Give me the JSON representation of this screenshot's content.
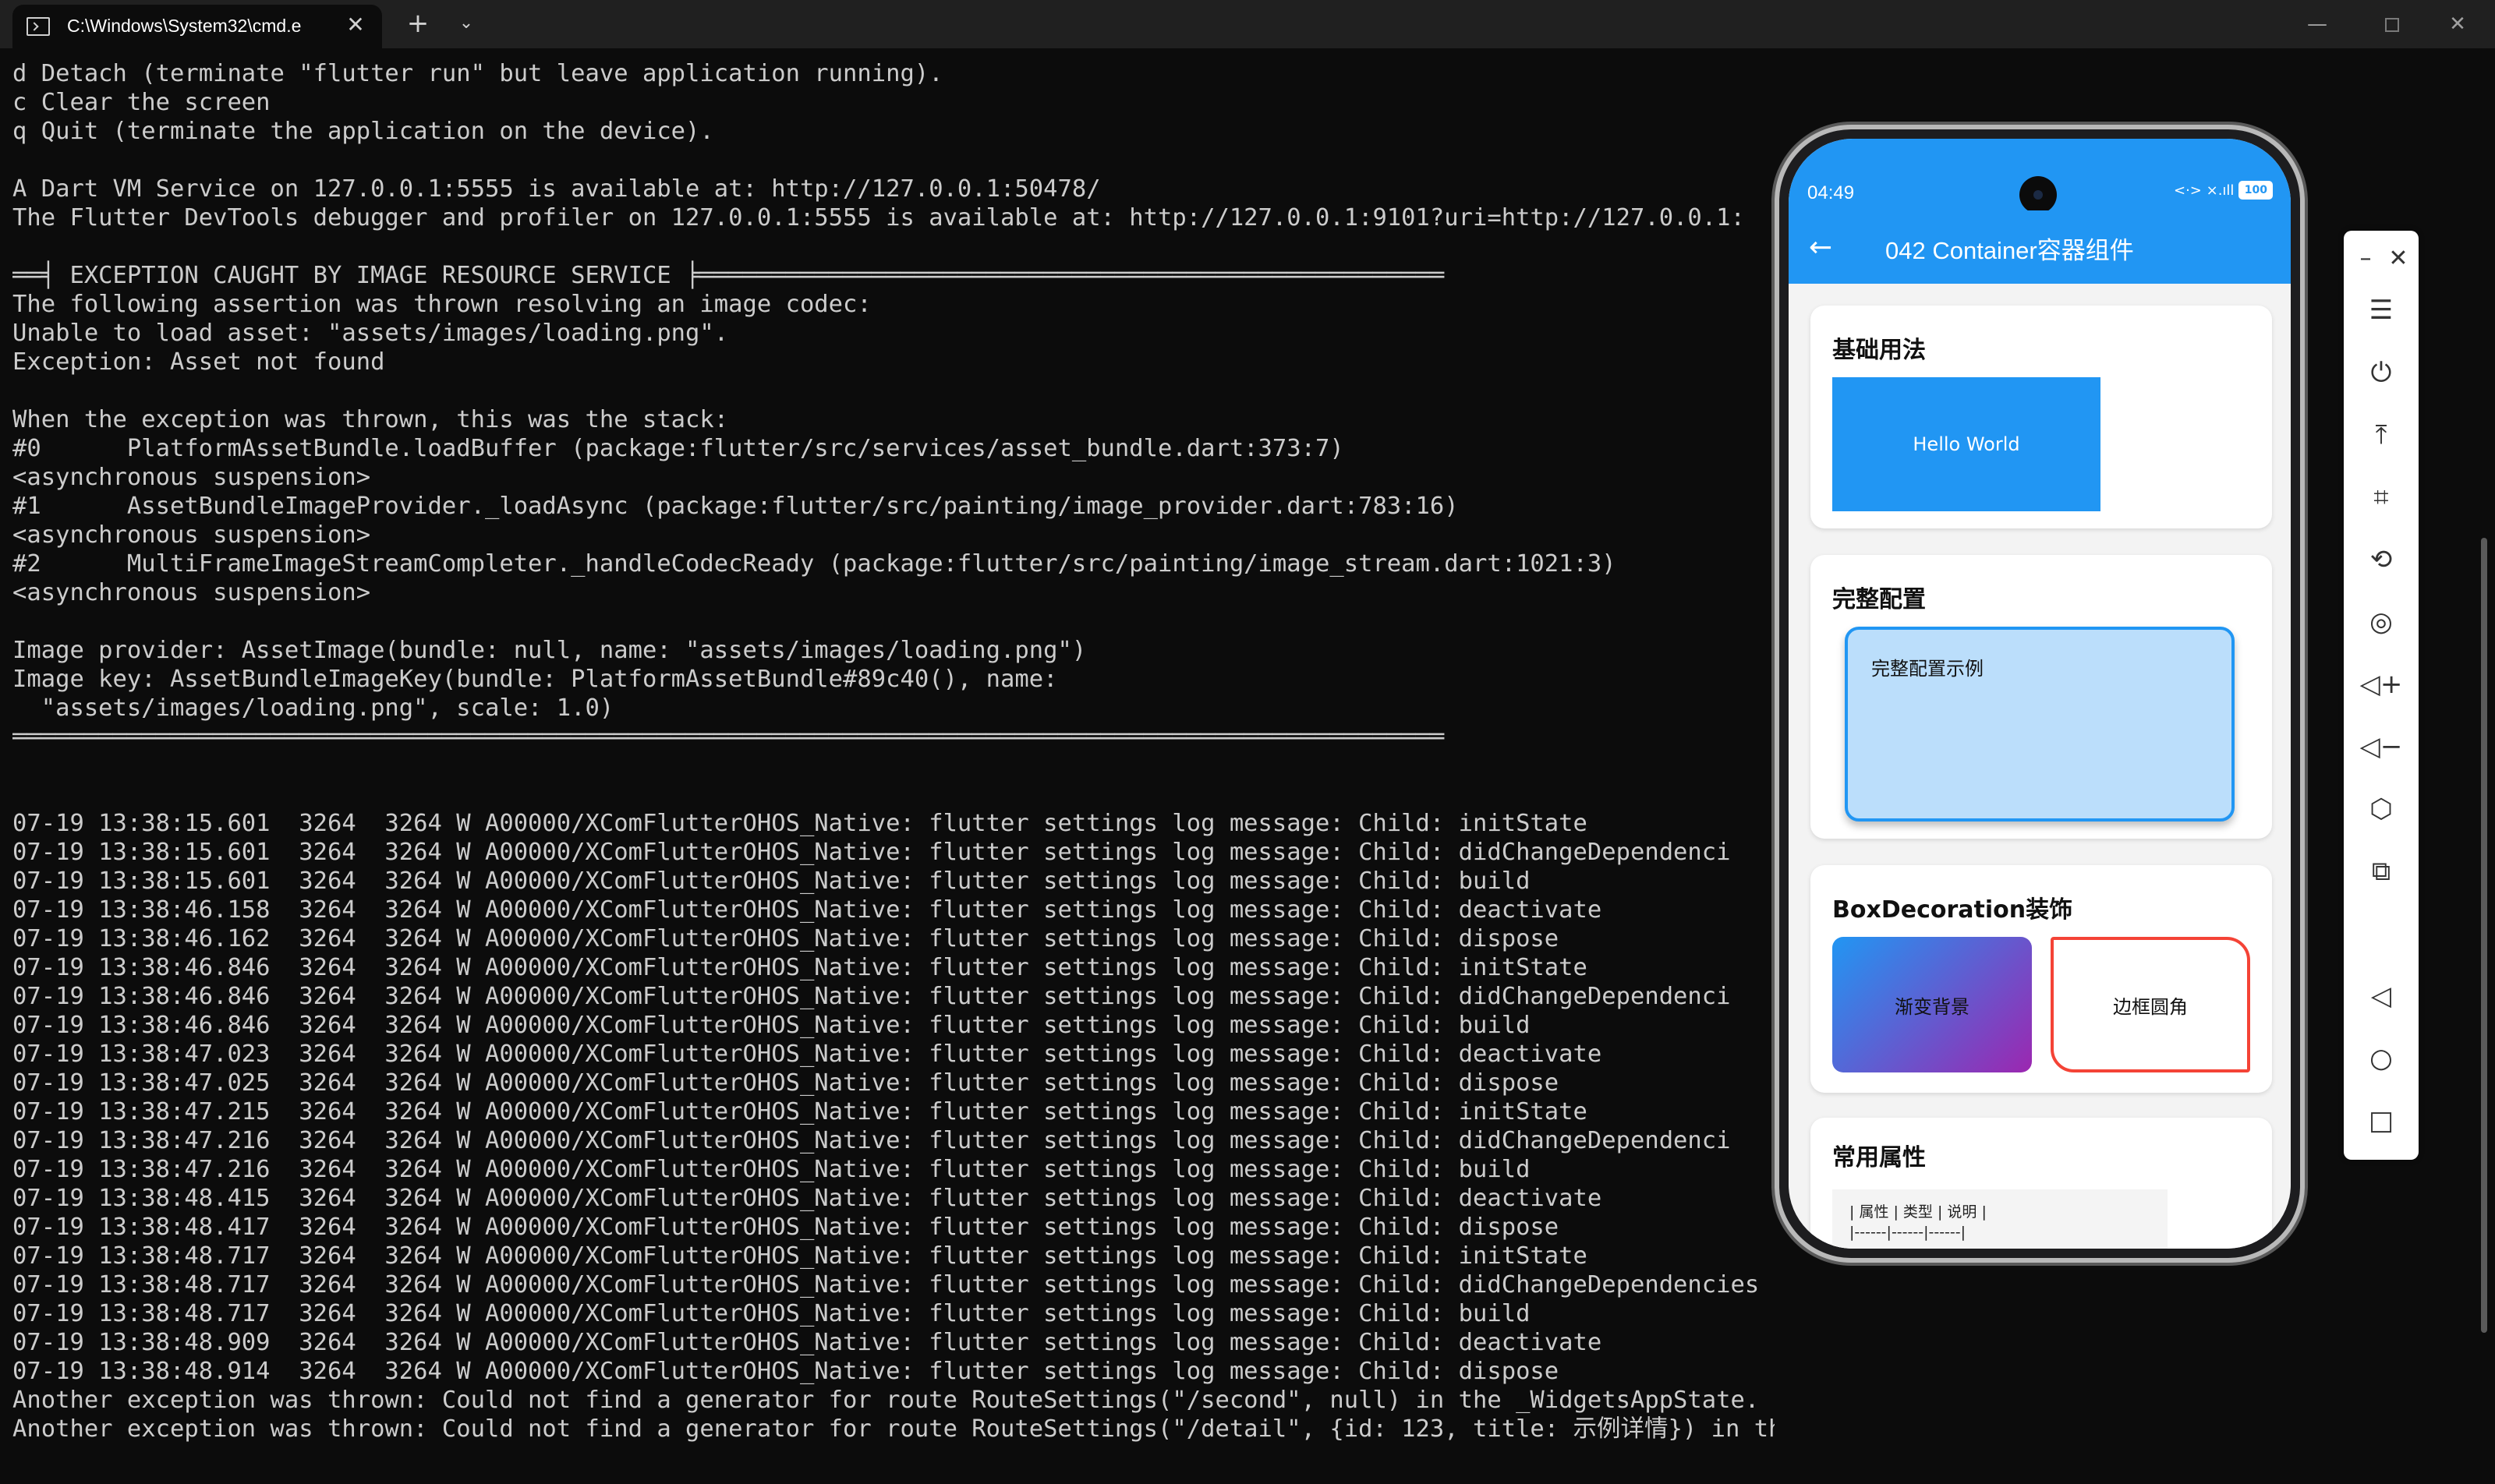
{
  "window": {
    "tab_title": "C:\\Windows\\System32\\cmd.e",
    "tab_close": "✕",
    "new_tab": "+",
    "dropdown": "⌄",
    "minimize": "—",
    "close": "✕"
  },
  "terminal": {
    "lines": [
      "d Detach (terminate \"flutter run\" but leave application running).",
      "c Clear the screen",
      "q Quit (terminate the application on the device).",
      "",
      "A Dart VM Service on 127.0.0.1:5555 is available at: http://127.0.0.1:50478/",
      "The Flutter DevTools debugger and profiler on 127.0.0.1:5555 is available at: http://127.0.0.1:9101?uri=http://127.0.0.1:",
      "",
      "══╡ EXCEPTION CAUGHT BY IMAGE RESOURCE SERVICE ╞════════════════════════════════════════════════════",
      "The following assertion was thrown resolving an image codec:",
      "Unable to load asset: \"assets/images/loading.png\".",
      "Exception: Asset not found",
      "",
      "When the exception was thrown, this was the stack:",
      "#0      PlatformAssetBundle.loadBuffer (package:flutter/src/services/asset_bundle.dart:373:7)",
      "<asynchronous suspension>",
      "#1      AssetBundleImageProvider._loadAsync (package:flutter/src/painting/image_provider.dart:783:16)",
      "<asynchronous suspension>",
      "#2      MultiFrameImageStreamCompleter._handleCodecReady (package:flutter/src/painting/image_stream.dart:1021:3)",
      "<asynchronous suspension>",
      "",
      "Image provider: AssetImage(bundle: null, name: \"assets/images/loading.png\")",
      "Image key: AssetBundleImageKey(bundle: PlatformAssetBundle#89c40(), name:",
      "  \"assets/images/loading.png\", scale: 1.0)",
      "════════════════════════════════════════════════════════════════════════════════════════════════════",
      "",
      "",
      "07-19 13:38:15.601  3264  3264 W A00000/XComFlutterOHOS_Native: flutter settings log message: Child: initState",
      "07-19 13:38:15.601  3264  3264 W A00000/XComFlutterOHOS_Native: flutter settings log message: Child: didChangeDependenci",
      "07-19 13:38:15.601  3264  3264 W A00000/XComFlutterOHOS_Native: flutter settings log message: Child: build",
      "07-19 13:38:46.158  3264  3264 W A00000/XComFlutterOHOS_Native: flutter settings log message: Child: deactivate",
      "07-19 13:38:46.162  3264  3264 W A00000/XComFlutterOHOS_Native: flutter settings log message: Child: dispose",
      "07-19 13:38:46.846  3264  3264 W A00000/XComFlutterOHOS_Native: flutter settings log message: Child: initState",
      "07-19 13:38:46.846  3264  3264 W A00000/XComFlutterOHOS_Native: flutter settings log message: Child: didChangeDependenci",
      "07-19 13:38:46.846  3264  3264 W A00000/XComFlutterOHOS_Native: flutter settings log message: Child: build",
      "07-19 13:38:47.023  3264  3264 W A00000/XComFlutterOHOS_Native: flutter settings log message: Child: deactivate",
      "07-19 13:38:47.025  3264  3264 W A00000/XComFlutterOHOS_Native: flutter settings log message: Child: dispose",
      "07-19 13:38:47.215  3264  3264 W A00000/XComFlutterOHOS_Native: flutter settings log message: Child: initState",
      "07-19 13:38:47.216  3264  3264 W A00000/XComFlutterOHOS_Native: flutter settings log message: Child: didChangeDependenci",
      "07-19 13:38:47.216  3264  3264 W A00000/XComFlutterOHOS_Native: flutter settings log message: Child: build",
      "07-19 13:38:48.415  3264  3264 W A00000/XComFlutterOHOS_Native: flutter settings log message: Child: deactivate",
      "07-19 13:38:48.417  3264  3264 W A00000/XComFlutterOHOS_Native: flutter settings log message: Child: dispose",
      "07-19 13:38:48.717  3264  3264 W A00000/XComFlutterOHOS_Native: flutter settings log message: Child: initState",
      "07-19 13:38:48.717  3264  3264 W A00000/XComFlutterOHOS_Native: flutter settings log message: Child: didChangeDependencies",
      "07-19 13:38:48.717  3264  3264 W A00000/XComFlutterOHOS_Native: flutter settings log message: Child: build",
      "07-19 13:38:48.909  3264  3264 W A00000/XComFlutterOHOS_Native: flutter settings log message: Child: deactivate",
      "07-19 13:38:48.914  3264  3264 W A00000/XComFlutterOHOS_Native: flutter settings log message: Child: dispose",
      "Another exception was thrown: Could not find a generator for route RouteSettings(\"/second\", null) in the _WidgetsAppState.",
      "Another exception was thrown: Could not find a generator for route RouteSettings(\"/detail\", {id: 123, title: 示例详情}) in the _WidgetsAppState."
    ]
  },
  "phone": {
    "time": "04:49",
    "status_icons": "<·> ×.ıll",
    "battery": "100",
    "back_arrow": "←",
    "title": "042 Container容器组件",
    "cards": {
      "basic": {
        "title": "基础用法",
        "box_text": "Hello World"
      },
      "full": {
        "title": "完整配置",
        "box_text": "完整配置示例"
      },
      "decoration": {
        "title": "BoxDecoration装饰",
        "gradient_text": "渐变背景",
        "border_text": "边框圆角"
      },
      "props": {
        "title": "常用属性",
        "row1": "| 属性 | 类型 | 说明 |",
        "row2": "|------|------|------|"
      }
    }
  },
  "toolbar": {
    "minimize": "–",
    "close": "✕",
    "menu": "☰",
    "power": "⏻",
    "to_top": "⤒",
    "crop": "⌗",
    "rotate": "⟲",
    "screenshot": "◎",
    "volume_up": "◁+",
    "volume_down": "◁−",
    "shake": "⬡",
    "record": "⧉",
    "back": "◁",
    "home": "○",
    "recents": "□"
  }
}
